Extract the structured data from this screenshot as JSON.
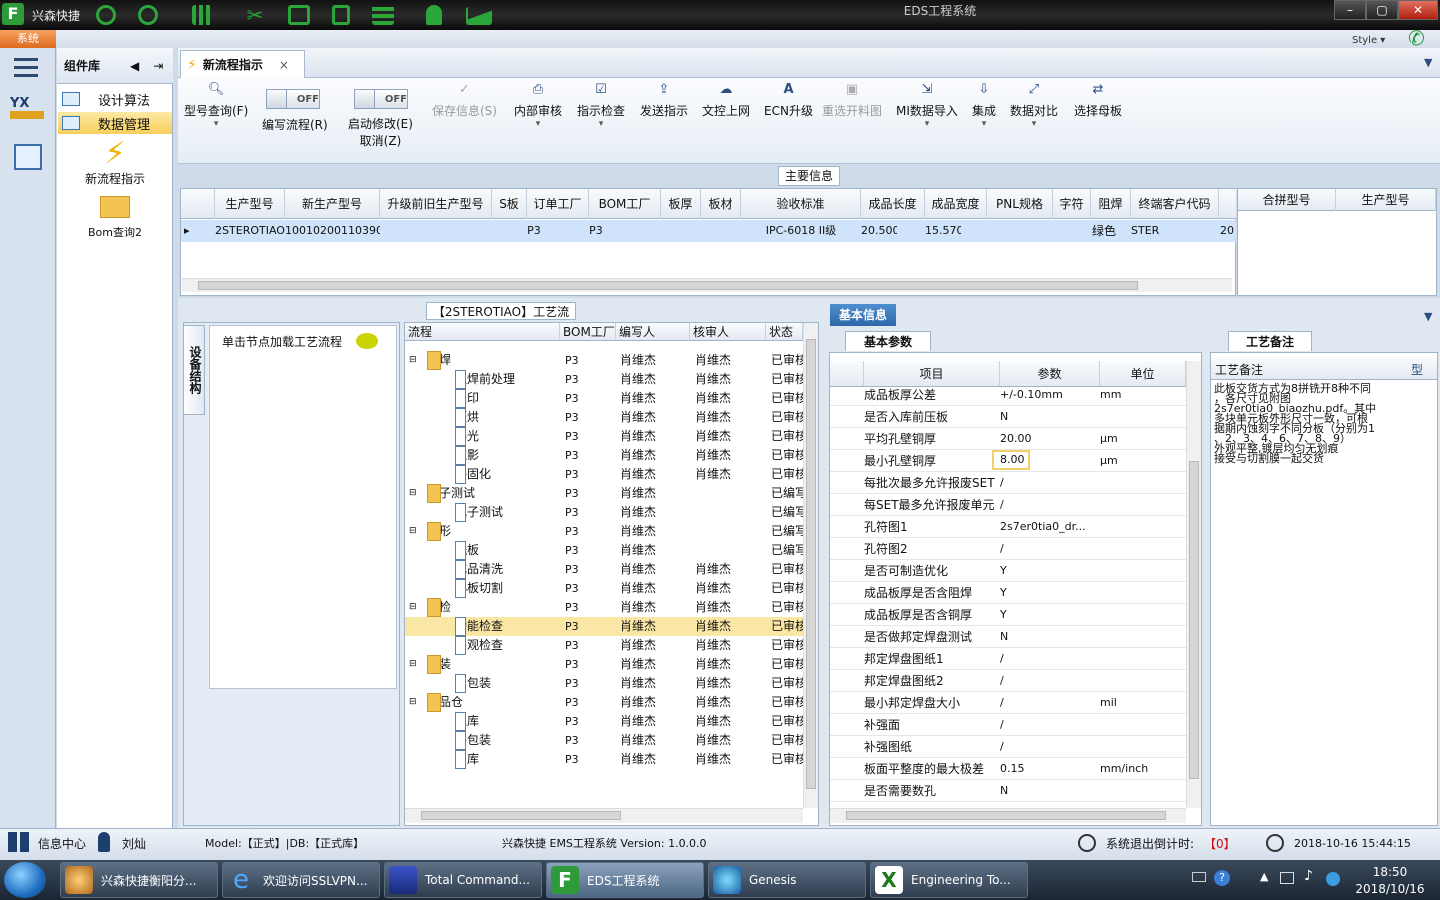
{
  "app": {
    "name": "兴森快捷",
    "window_title": "EDS工程系统",
    "system_tab": "系统",
    "style_label": "Style"
  },
  "component_panel": {
    "title": "组件库",
    "items": [
      {
        "label": "设计算法"
      },
      {
        "label": "数据管理"
      }
    ],
    "big_items": [
      {
        "label": "新流程指示"
      },
      {
        "label": "Bom查询2"
      }
    ]
  },
  "doc_tab": {
    "label": "新流程指示"
  },
  "ribbon": {
    "type_query": "型号查询(F)",
    "toggle_off": "OFF",
    "edit_flow": "编写流程(R)",
    "start_modify_1": "启动修改(E)",
    "start_modify_2": "取消(Z)",
    "save_info": "保存信息(S)",
    "internal_review": "内部审核",
    "instruction_check": "指示检查",
    "send_instruction": "发送指示",
    "doc_upload": "文控上网",
    "ecn_upgrade": "ECN升级",
    "reselect_material": "重选开料图",
    "mi_import": "MI数据导入",
    "integrate": "集成",
    "data_compare": "数据对比",
    "select_master": "选择母板"
  },
  "main_info": {
    "title": "主要信息",
    "columns": [
      "生产型号",
      "新生产型号",
      "升级前旧生产型号",
      "S板",
      "订单工厂",
      "BOM工厂",
      "板厚",
      "板材",
      "验收标准",
      "成品长度",
      "成品宽度",
      "PNL规格",
      "字符",
      "阻焊",
      "终端客户代码"
    ],
    "row": [
      "2STEROTIAO",
      "10010200110390",
      "",
      "",
      "P3",
      "P3",
      "",
      "",
      "IPC-6018 II级",
      "20.500",
      "15.570",
      "",
      "",
      "绿色",
      "STER"
    ],
    "row_tail": "20",
    "side_columns": [
      "合拼型号",
      "生产型号"
    ]
  },
  "flow_panel": {
    "title": "【2STEROTIAO】工艺流程",
    "side_tab": "设备结构",
    "node_hint": "单击节点加载工艺流程",
    "columns": [
      "流程",
      "BOM工厂",
      "编写人",
      "核审人",
      "状态"
    ],
    "rows": [
      {
        "level": 1,
        "type": "folder",
        "name": "阻焊",
        "bom": "P3",
        "author": "肖维杰",
        "reviewer": "肖维杰",
        "status": "已审核"
      },
      {
        "level": 2,
        "type": "page",
        "name": "阻焊前处理",
        "bom": "P3",
        "author": "肖维杰",
        "reviewer": "肖维杰",
        "status": "已审核"
      },
      {
        "level": 2,
        "type": "page",
        "name": "丝印",
        "bom": "P3",
        "author": "肖维杰",
        "reviewer": "肖维杰",
        "status": "已审核"
      },
      {
        "level": 2,
        "type": "page",
        "name": "预烘",
        "bom": "P3",
        "author": "肖维杰",
        "reviewer": "肖维杰",
        "status": "已审核"
      },
      {
        "level": 2,
        "type": "page",
        "name": "曝光",
        "bom": "P3",
        "author": "肖维杰",
        "reviewer": "肖维杰",
        "status": "已审核"
      },
      {
        "level": 2,
        "type": "page",
        "name": "显影",
        "bom": "P3",
        "author": "肖维杰",
        "reviewer": "肖维杰",
        "status": "已审核"
      },
      {
        "level": 2,
        "type": "page",
        "name": "终固化",
        "bom": "P3",
        "author": "肖维杰",
        "reviewer": "肖维杰",
        "status": "已审核"
      },
      {
        "level": 1,
        "type": "folder",
        "name": "电子测试",
        "bom": "P3",
        "author": "肖维杰",
        "reviewer": "",
        "status": "已编写"
      },
      {
        "level": 2,
        "type": "page",
        "name": "电子测试",
        "bom": "P3",
        "author": "肖维杰",
        "reviewer": "",
        "status": "已编写"
      },
      {
        "level": 1,
        "type": "folder",
        "name": "外形",
        "bom": "P3",
        "author": "肖维杰",
        "reviewer": "",
        "status": "已编写"
      },
      {
        "level": 2,
        "type": "page",
        "name": "铣板",
        "bom": "P3",
        "author": "肖维杰",
        "reviewer": "",
        "status": "已编写"
      },
      {
        "level": 2,
        "type": "page",
        "name": "成品清洗",
        "bom": "P3",
        "author": "肖维杰",
        "reviewer": "肖维杰",
        "status": "已审核"
      },
      {
        "level": 2,
        "type": "page",
        "name": "小板切割",
        "bom": "P3",
        "author": "肖维杰",
        "reviewer": "肖维杰",
        "status": "已审核"
      },
      {
        "level": 1,
        "type": "folder",
        "name": "终检",
        "bom": "P3",
        "author": "肖维杰",
        "reviewer": "肖维杰",
        "status": "已审核"
      },
      {
        "level": 2,
        "type": "page",
        "name": "功能检查",
        "bom": "P3",
        "author": "肖维杰",
        "reviewer": "肖维杰",
        "status": "已审核",
        "selected": true
      },
      {
        "level": 2,
        "type": "page",
        "name": "外观检查",
        "bom": "P3",
        "author": "肖维杰",
        "reviewer": "肖维杰",
        "status": "已审核"
      },
      {
        "level": 1,
        "type": "folder",
        "name": "包装",
        "bom": "P3",
        "author": "肖维杰",
        "reviewer": "肖维杰",
        "status": "已审核"
      },
      {
        "level": 2,
        "type": "page",
        "name": "内包装",
        "bom": "P3",
        "author": "肖维杰",
        "reviewer": "肖维杰",
        "status": "已审核"
      },
      {
        "level": 1,
        "type": "folder",
        "name": "成品仓",
        "bom": "P3",
        "author": "肖维杰",
        "reviewer": "肖维杰",
        "status": "已审核"
      },
      {
        "level": 2,
        "type": "page",
        "name": "入库",
        "bom": "P3",
        "author": "肖维杰",
        "reviewer": "肖维杰",
        "status": "已审核"
      },
      {
        "level": 2,
        "type": "page",
        "name": "外包装",
        "bom": "P3",
        "author": "肖维杰",
        "reviewer": "肖维杰",
        "status": "已审核"
      },
      {
        "level": 2,
        "type": "page",
        "name": "出库",
        "bom": "P3",
        "author": "肖维杰",
        "reviewer": "肖维杰",
        "status": "已审核"
      }
    ]
  },
  "basic_info": {
    "tab": "基本信息",
    "params_tab": "基本参数",
    "columns": [
      "项目",
      "参数",
      "单位"
    ],
    "edit_value": "8.00",
    "rows": [
      [
        "成品板厚公差",
        "+/-0.10mm",
        "mm"
      ],
      [
        "是否入库前压板",
        "N",
        ""
      ],
      [
        "平均孔壁铜厚",
        "20.00",
        "μm"
      ],
      [
        "最小孔壁铜厚",
        "8.00",
        "μm"
      ],
      [
        "每批次最多允许报废SET",
        "/",
        ""
      ],
      [
        "每SET最多允许报废单元",
        "/",
        ""
      ],
      [
        "孔符图1",
        "2s7er0tia0_dr...",
        ""
      ],
      [
        "孔符图2",
        "/",
        ""
      ],
      [
        "是否可制造优化",
        "Y",
        ""
      ],
      [
        "成品板厚是否含阻焊",
        "Y",
        ""
      ],
      [
        "成品板厚是否含铜厚",
        "Y",
        ""
      ],
      [
        "是否做邦定焊盘测试",
        "N",
        ""
      ],
      [
        "邦定焊盘图纸1",
        "/",
        ""
      ],
      [
        "邦定焊盘图纸2",
        "/",
        ""
      ],
      [
        "最小邦定焊盘大小",
        "/",
        "mil"
      ],
      [
        "补强面",
        "/",
        ""
      ],
      [
        "补强图纸",
        "/",
        ""
      ],
      [
        "板面平整度的最大极差",
        "0.15",
        "mm/inch"
      ],
      [
        "是否需要数孔",
        "N",
        ""
      ]
    ],
    "notes_tab": "工艺备注",
    "notes_head": "工艺备注",
    "notes_head2": "型",
    "notes_text": "此板交货方式为8拼铣开8种不同\n，各尺寸见附图\n2s7er0tia0_biaozhu.pdf。其中\n多块单元板外形尺寸一致，可根\n据期内蚀刻字不同分板（分别为1\n、2、3、4、6、7、8、9）\n外观平整,镀层均匀无划痕\n接受与切割膜一起交货"
  },
  "status_bar": {
    "info_center": "信息中心",
    "user": "刘灿",
    "model": "Model:【正式】|DB:【正式库】",
    "system_version": "兴森快捷 EMS工程系统 Version: 1.0.0.0",
    "logout_label": "系统退出倒计时:",
    "logout_value": "【0】",
    "datetime": "2018-10-16 15:44:15"
  },
  "taskbar": {
    "tasks": [
      "兴森快捷衡阳分...",
      "欢迎访问SSLVPN...",
      "Total Command...",
      "EDS工程系统",
      "Genesis",
      "Engineering To..."
    ],
    "time": "18:50",
    "date": "2018/10/16"
  },
  "colors": {
    "accent": "#2e67a8",
    "selection": "#fbe7a5",
    "row_highlight": "#cfe3fa",
    "close": "#c2301a"
  }
}
